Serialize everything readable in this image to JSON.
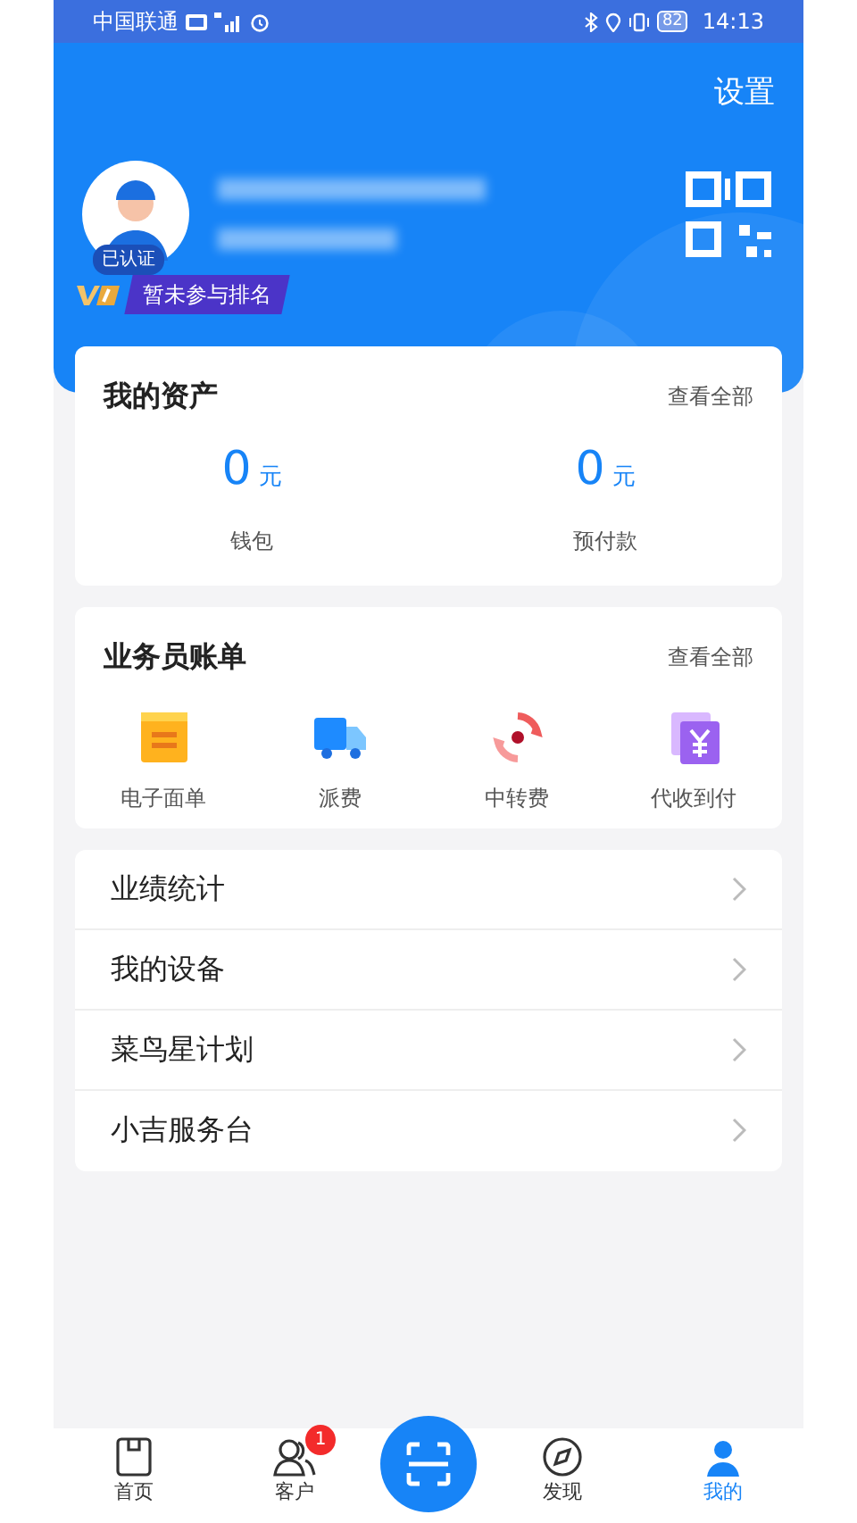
{
  "status_bar": {
    "carrier": "中国联通",
    "battery": "82",
    "time": "14:13"
  },
  "header": {
    "settings": "设置",
    "verified": "已认证",
    "rank_badge": "暂未参与排名"
  },
  "assets": {
    "title": "我的资产",
    "more": "查看全部",
    "items": [
      {
        "amount": "0",
        "unit": "元",
        "label": "钱包"
      },
      {
        "amount": "0",
        "unit": "元",
        "label": "预付款"
      }
    ]
  },
  "bills": {
    "title": "业务员账单",
    "more": "查看全部",
    "items": [
      {
        "label": "电子面单",
        "kind": "sheet"
      },
      {
        "label": "派费",
        "kind": "truck"
      },
      {
        "label": "中转费",
        "kind": "transfer"
      },
      {
        "label": "代收到付",
        "kind": "yuan"
      }
    ]
  },
  "menu": [
    {
      "label": "业绩统计"
    },
    {
      "label": "我的设备"
    },
    {
      "label": "菜鸟星计划"
    },
    {
      "label": "小吉服务台"
    }
  ],
  "tab_bar": [
    {
      "label": "首页",
      "kind": "home",
      "selected": false
    },
    {
      "label": "客户",
      "kind": "contacts",
      "selected": false,
      "badge": "1"
    },
    {
      "label": "发现",
      "kind": "discover",
      "selected": false
    },
    {
      "label": "我的",
      "kind": "me",
      "selected": true
    }
  ]
}
